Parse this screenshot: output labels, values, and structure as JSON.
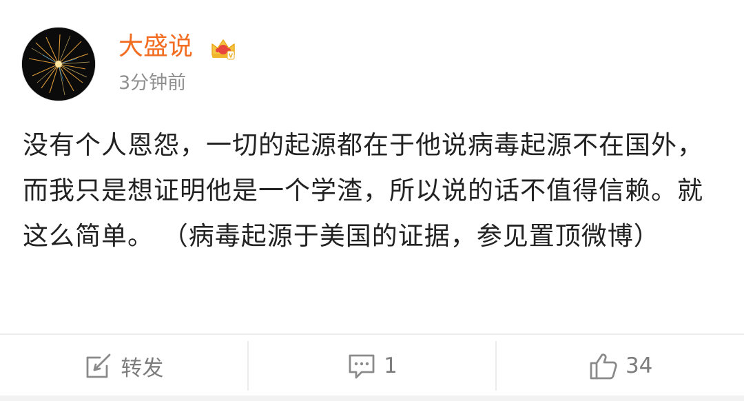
{
  "post": {
    "author": {
      "name": "大盛说",
      "badge_icon": "vip-crown-icon",
      "avatar_icon": "avatar-fireworks-icon"
    },
    "timestamp": "3分钟前",
    "text": "没有个人恩怨，一切的起源都在于他说病毒起源不在国外，而我只是想证明他是一个学渣，所以说的话不值得信赖。就这么简单。 （病毒起源于美国的证据，参见置顶微博）"
  },
  "actions": {
    "repost": {
      "icon": "repost-icon",
      "label": "转发"
    },
    "comment": {
      "icon": "comment-icon",
      "count": "1"
    },
    "like": {
      "icon": "thumbs-up-icon",
      "count": "34"
    }
  },
  "colors": {
    "username": "#f26d21",
    "meta": "#8f8f8f",
    "action": "#7d7d7d",
    "divider": "#ececec"
  }
}
